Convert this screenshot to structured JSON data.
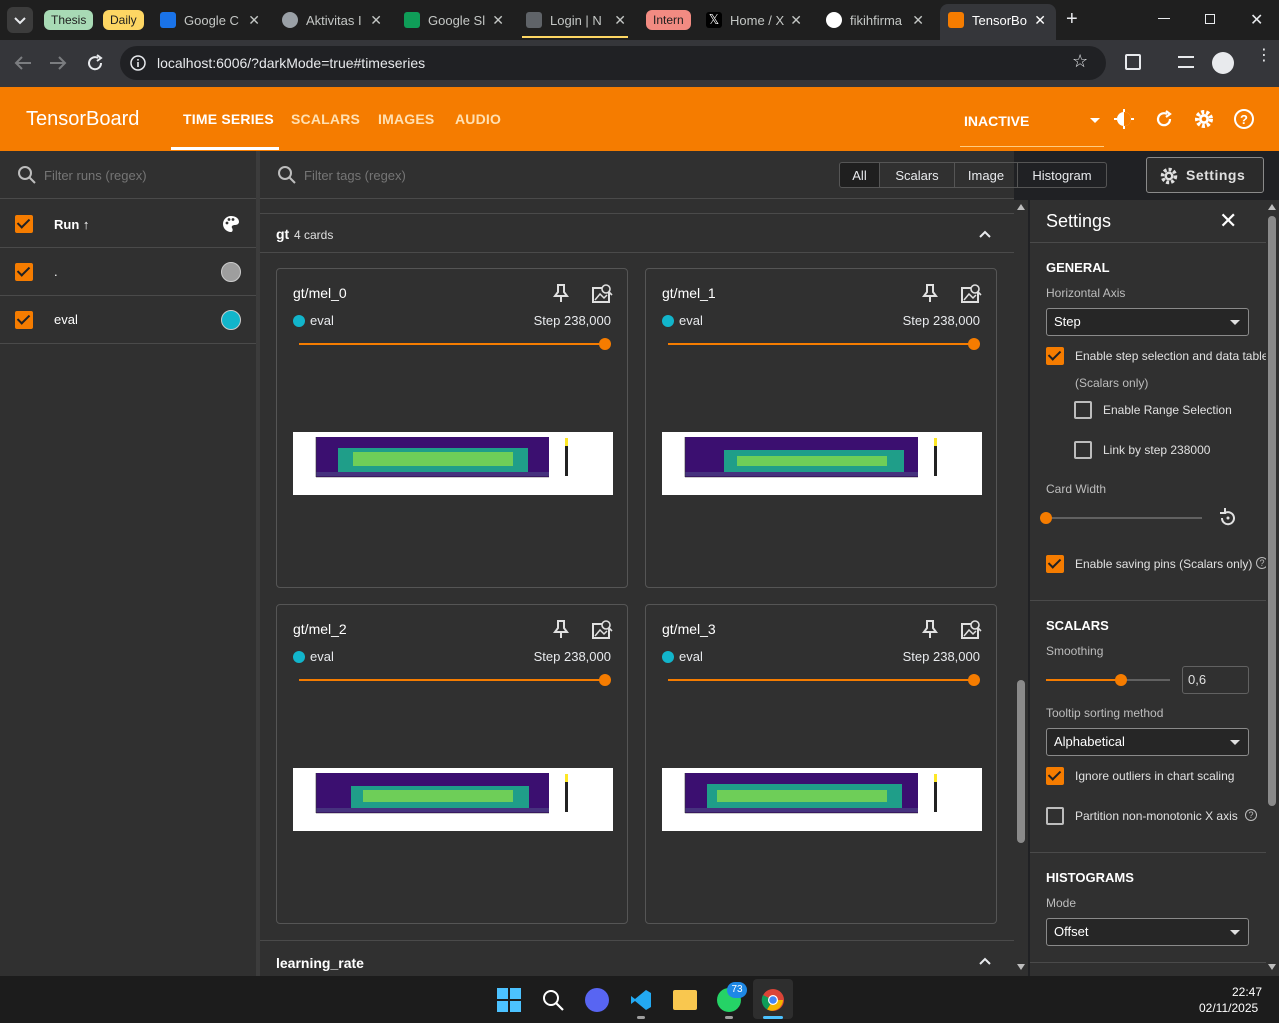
{
  "browser": {
    "tab_groups": [
      "Thesis",
      "Daily",
      "Intern"
    ],
    "tabs": [
      {
        "label": "Google C",
        "fav_color": "#1a73e8",
        "icon": "google-calendar-icon"
      },
      {
        "label": "Aktivitas I",
        "fav_color": "#9aa0a6",
        "icon": "aktivitas-icon"
      },
      {
        "label": "Google Sl",
        "fav_color": "#0f9d58",
        "icon": "google-sheets-icon"
      },
      {
        "label": "Login | N",
        "fav_color": "#5f6368",
        "icon": "login-icon"
      },
      {
        "label": "Home / X",
        "fav_color": "#000000",
        "icon": "x-icon"
      },
      {
        "label": "fikihfirma",
        "fav_color": "#ffffff",
        "icon": "github-icon"
      },
      {
        "label": "TensorBo",
        "fav_color": "#f57c00",
        "icon": "tensorboard-icon"
      }
    ],
    "url": "localhost:6006/?darkMode=true#timeseries"
  },
  "header": {
    "brand": "TensorBoard",
    "tabs": [
      "TIME SERIES",
      "SCALARS",
      "IMAGES",
      "AUDIO"
    ],
    "active_tab": "TIME SERIES",
    "status": "INACTIVE"
  },
  "runs": {
    "filter_placeholder": "Filter runs (regex)",
    "column": "Run ↑",
    "items": [
      {
        "name": ".",
        "color": "#9e9e9e"
      },
      {
        "name": "eval",
        "color": "#12b5cb"
      }
    ]
  },
  "main": {
    "filter_placeholder": "Filter tags (regex)",
    "chips": [
      "All",
      "Scalars",
      "Image",
      "Histogram"
    ],
    "settings_button": "Settings",
    "group": {
      "name": "gt",
      "count": "4 cards"
    },
    "cards": [
      {
        "title": "gt/mel_0",
        "run": "eval",
        "step": "Step 238,000"
      },
      {
        "title": "gt/mel_1",
        "run": "eval",
        "step": "Step 238,000"
      },
      {
        "title": "gt/mel_2",
        "run": "eval",
        "step": "Step 238,000"
      },
      {
        "title": "gt/mel_3",
        "run": "eval",
        "step": "Step 238,000"
      }
    ],
    "next_group": "learning_rate"
  },
  "settings": {
    "title": "Settings",
    "general": "GENERAL",
    "horizontal_axis_label": "Horizontal Axis",
    "horizontal_axis": "Step",
    "enable_step_selection": "Enable step selection and data table",
    "scalars_only": "(Scalars only)",
    "enable_range_selection": "Enable Range Selection",
    "link_by_step": "Link by step 238000",
    "card_width": "Card Width",
    "enable_saving_pins": "Enable saving pins (Scalars only)",
    "scalars": "SCALARS",
    "smoothing_label": "Smoothing",
    "smoothing_value": "0,6",
    "tooltip_sorting_label": "Tooltip sorting method",
    "tooltip_sorting": "Alphabetical",
    "ignore_outliers": "Ignore outliers in chart scaling",
    "partition": "Partition non-monotonic X axis",
    "histograms": "HISTOGRAMS",
    "mode_label": "Mode",
    "mode": "Offset"
  },
  "taskbar": {
    "time": "22:47",
    "date": "02/11/2025",
    "whatsapp_badge": "73"
  }
}
